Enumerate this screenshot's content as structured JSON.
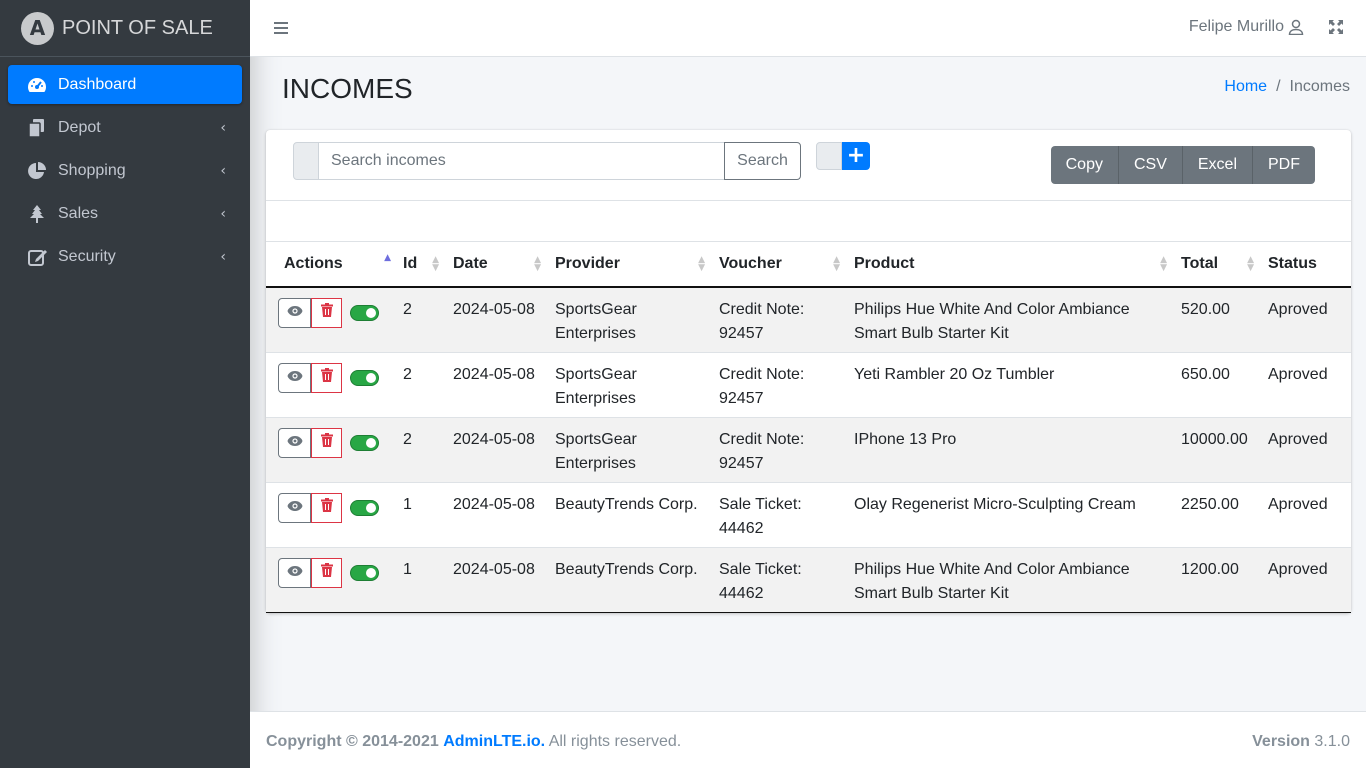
{
  "brand": {
    "logo_letter": "A",
    "name": "POINT OF SALE"
  },
  "sidebar": {
    "items": [
      {
        "label": "Dashboard",
        "icon": "tachometer-icon",
        "active": true
      },
      {
        "label": "Depot",
        "icon": "copy-icon",
        "arrow": "‹"
      },
      {
        "label": "Shopping",
        "icon": "chart-pie-icon",
        "arrow": "‹"
      },
      {
        "label": "Sales",
        "icon": "tree-icon",
        "arrow": "‹"
      },
      {
        "label": "Security",
        "icon": "edit-icon",
        "arrow": "‹"
      }
    ]
  },
  "topbar": {
    "user_name": "Felipe Murillo"
  },
  "header": {
    "title": "INCOMES",
    "breadcrumb_home": "Home",
    "breadcrumb_sep": "/",
    "breadcrumb_current": "Incomes"
  },
  "toolbar": {
    "search_placeholder": "Search incomes",
    "search_label": "Search",
    "add_label": "+",
    "export": {
      "copy": "Copy",
      "csv": "CSV",
      "excel": "Excel",
      "pdf": "PDF"
    }
  },
  "table": {
    "columns": [
      "Actions",
      "Id",
      "Date",
      "Provider",
      "Voucher",
      "Product",
      "Total",
      "Status"
    ],
    "sorted_column": "Actions",
    "rows": [
      {
        "id": "2",
        "date": "2024-05-08",
        "provider": "SportsGear Enterprises",
        "voucher": "Credit Note: 92457",
        "product": "Philips Hue White And Color Ambiance Smart Bulb Starter Kit",
        "total": "520.00",
        "status": "Aproved"
      },
      {
        "id": "2",
        "date": "2024-05-08",
        "provider": "SportsGear Enterprises",
        "voucher": "Credit Note: 92457",
        "product": "Yeti Rambler 20 Oz Tumbler",
        "total": "650.00",
        "status": "Aproved"
      },
      {
        "id": "2",
        "date": "2024-05-08",
        "provider": "SportsGear Enterprises",
        "voucher": "Credit Note: 92457",
        "product": "IPhone 13 Pro",
        "total": "10000.00",
        "status": "Aproved"
      },
      {
        "id": "1",
        "date": "2024-05-08",
        "provider": "BeautyTrends Corp.",
        "voucher": "Sale Ticket: 44462",
        "product": "Olay Regenerist Micro-Sculpting Cream",
        "total": "2250.00",
        "status": "Aproved"
      },
      {
        "id": "1",
        "date": "2024-05-08",
        "provider": "BeautyTrends Corp.",
        "voucher": "Sale Ticket: 44462",
        "product": "Philips Hue White And Color Ambiance Smart Bulb Starter Kit",
        "total": "1200.00",
        "status": "Aproved"
      }
    ]
  },
  "footer": {
    "copyright": "Copyright © 2014-2021",
    "link": "AdminLTE.io.",
    "rights": " All rights reserved.",
    "version_label": "Version",
    "version": "3.1.0"
  },
  "colors": {
    "accent": "#007bff",
    "sidebar_bg": "#343a40",
    "danger": "#dc3545",
    "success": "#28a745",
    "secondary": "#6c757d"
  }
}
